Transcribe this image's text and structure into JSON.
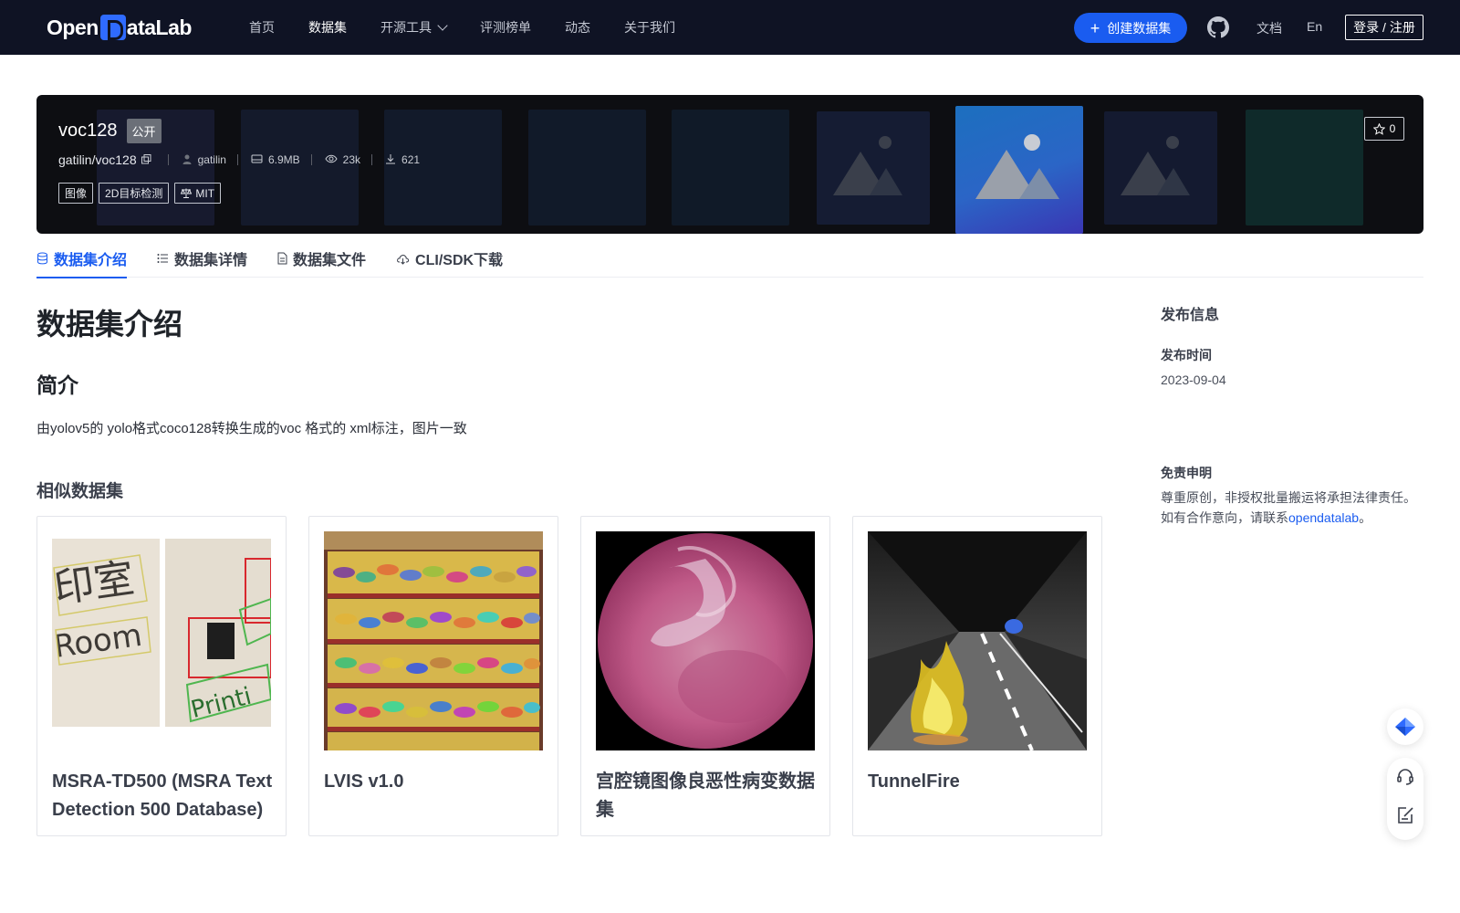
{
  "nav": {
    "logo": "OpenDataLab",
    "items": [
      {
        "label": "首页",
        "active": false
      },
      {
        "label": "数据集",
        "active": true
      },
      {
        "label": "开源工具",
        "active": false,
        "dropdown": true
      },
      {
        "label": "评测榜单",
        "active": false
      },
      {
        "label": "动态",
        "active": false
      },
      {
        "label": "关于我们",
        "active": false
      }
    ],
    "create_label": "创建数据集",
    "github_icon": "github-icon",
    "docs_label": "文档",
    "lang_label": "En",
    "login_label": "登录 / 注册"
  },
  "dataset": {
    "name": "voc128",
    "visibility": "公开",
    "path": "gatilin/voc128",
    "owner": "gatilin",
    "size": "6.9MB",
    "views": "23k",
    "downloads": "621",
    "tags": [
      "图像",
      "2D目标检测",
      "MIT"
    ],
    "stars": "0"
  },
  "tabs": [
    {
      "label": "数据集介绍",
      "icon": "database-icon",
      "active": true
    },
    {
      "label": "数据集详情",
      "icon": "list-icon",
      "active": false
    },
    {
      "label": "数据集文件",
      "icon": "file-icon",
      "active": false
    },
    {
      "label": "CLI/SDK下载",
      "icon": "cloud-download-icon",
      "active": false
    }
  ],
  "main": {
    "heading": "数据集介绍",
    "section_title": "简介",
    "intro_text": "由yolov5的 yolo格式coco128转换生成的voc 格式的 xml标注，图片一致",
    "similar_title": "相似数据集",
    "similar": [
      {
        "name": "MSRA-TD500 (MSRA Text Detection 500 Database)"
      },
      {
        "name": "LVIS v1.0"
      },
      {
        "name": "宫腔镜图像良恶性病变数据集"
      },
      {
        "name": "TunnelFire"
      }
    ]
  },
  "sidebar": {
    "title": "发布信息",
    "publish_label": "发布时间",
    "publish_date": "2023-09-04",
    "disclaimer_label": "免责申明",
    "disclaimer_text": "尊重原创，非授权批量搬运将承担法律责任。如有合作意向，请联系",
    "disclaimer_link": "opendatalab",
    "disclaimer_end": "。"
  },
  "colors": {
    "nav_bg": "#0f1324",
    "accent": "#1a5cf0",
    "banner_bg": "#0d0e12"
  }
}
